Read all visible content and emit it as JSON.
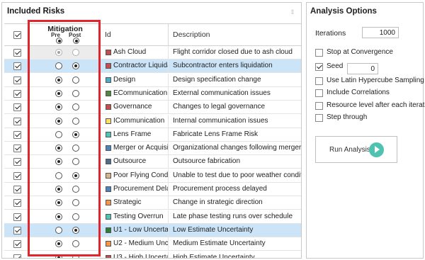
{
  "left_panel": {
    "title": "Included Risks",
    "header": {
      "all_checked": true,
      "mitigation_label": "Mitigation",
      "pre_label": "Pre",
      "post_label": "Post",
      "id_label": "Id",
      "description_label": "Description"
    },
    "rows": [
      {
        "id": "Ash Cloud",
        "description": "Flight corridor closed due to ash cloud",
        "color": "#c0504d",
        "checked": true,
        "mitigation": "pre"
      },
      {
        "id": "Contractor Liquidat",
        "description": "Subcontractor enters liquidation",
        "color": "#c0504d",
        "checked": true,
        "mitigation": "post"
      },
      {
        "id": "Design",
        "description": "Design specification change",
        "color": "#4bacc6",
        "checked": true,
        "mitigation": "pre"
      },
      {
        "id": "ECommunication",
        "description": "External communication issues",
        "color": "#4f8a3c",
        "checked": true,
        "mitigation": "pre"
      },
      {
        "id": "Governance",
        "description": "Changes to legal governance",
        "color": "#c0504d",
        "checked": true,
        "mitigation": "pre"
      },
      {
        "id": "ICommunication",
        "description": "Internal communication issues",
        "color": "#ffe066",
        "checked": true,
        "mitigation": "pre"
      },
      {
        "id": "Lens Frame",
        "description": "Fabricate Lens Frame Risk",
        "color": "#4bc6b4",
        "checked": true,
        "mitigation": "post"
      },
      {
        "id": "Merger or Acquisitio",
        "description": "Organizational changes following merger or",
        "color": "#4f81bd",
        "checked": true,
        "mitigation": "pre"
      },
      {
        "id": "Outsource",
        "description": "Outsource fabrication",
        "color": "#4f6d8a",
        "checked": true,
        "mitigation": "pre"
      },
      {
        "id": "Poor Flying Conditi",
        "description": "Unable to test due to poor weather condition",
        "color": "#d9b38c",
        "checked": true,
        "mitigation": "post"
      },
      {
        "id": "Procurement Delays",
        "description": "Procurement process delayed",
        "color": "#4f81bd",
        "checked": true,
        "mitigation": "pre"
      },
      {
        "id": "Strategic",
        "description": "Change in strategic direction",
        "color": "#f79646",
        "checked": true,
        "mitigation": "pre"
      },
      {
        "id": "Testing Overrun",
        "description": "Late phase testing runs over schedule",
        "color": "#4bc6b4",
        "checked": true,
        "mitigation": "pre"
      },
      {
        "id": "U1 - Low Uncertaint",
        "description": "Low Estimate Uncertainty",
        "color": "#2e7d32",
        "checked": true,
        "mitigation": "post"
      },
      {
        "id": "U2 - Medium Uncer",
        "description": "Medium Estimate Uncertainty",
        "color": "#f79646",
        "checked": true,
        "mitigation": "pre"
      },
      {
        "id": "U3 - High Uncertain",
        "description": "High Estimate Uncertainty",
        "color": "#c0504d",
        "checked": true,
        "mitigation": "pre"
      }
    ],
    "highlight_color": "#e0262c"
  },
  "right_panel": {
    "title": "Analysis Options",
    "iterations_label": "Iterations",
    "iterations_value": "1000",
    "options": [
      {
        "label": "Stop at Convergence",
        "checked": false
      },
      {
        "label": "Seed",
        "checked": true
      },
      {
        "label": "Use Latin Hypercube Sampling",
        "checked": false
      },
      {
        "label": "Include Correlations",
        "checked": false
      },
      {
        "label": "Resource level after each iteration",
        "checked": false
      },
      {
        "label": "Step through",
        "checked": false
      }
    ],
    "seed_value": "0",
    "run_button_label": "Run Analysis",
    "run_icon_color": "#4fc3b0"
  }
}
